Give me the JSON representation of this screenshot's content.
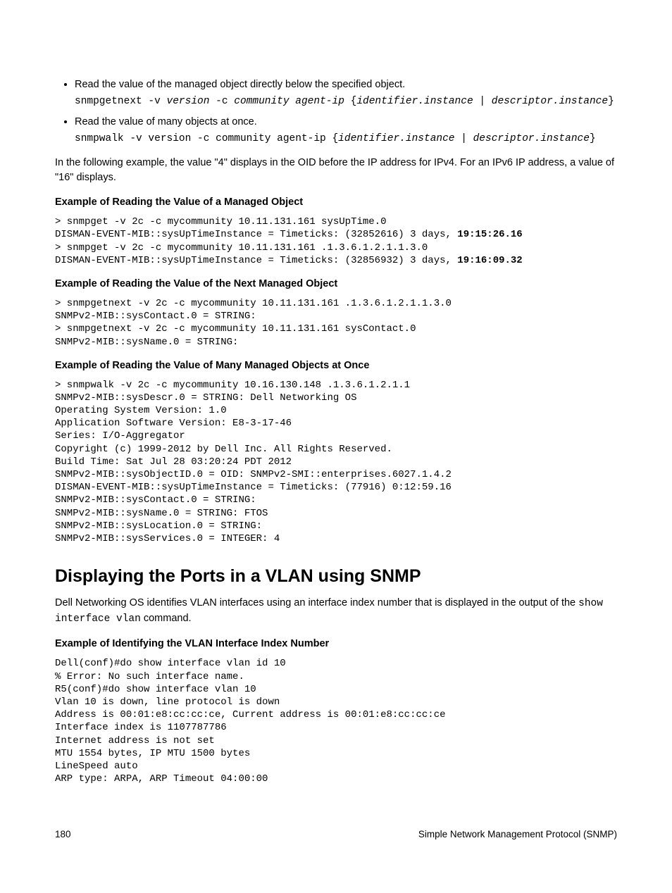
{
  "bullets": {
    "item1": "Read the value of the managed object directly below the specified object.",
    "syntax1a": "snmpgetnext -v ",
    "syntax1b": "version",
    "syntax1c": " -c ",
    "syntax1d": "community agent-ip",
    "syntax1e": " {",
    "syntax1f": "identifier.instance",
    "syntax1g": " | ",
    "syntax1h": "descriptor.instance",
    "syntax1i": "}",
    "item2": "Read the value of many objects at once.",
    "syntax2a": "snmpwalk -v version -c community agent-ip {",
    "syntax2b": "identifier.instance",
    "syntax2c": " | ",
    "syntax2d": "descriptor.instance",
    "syntax2e": "}"
  },
  "para1": "In the following example, the value \"4\" displays in the OID before the IP address for IPv4. For an IPv6 IP address, a value of \"16\" displays.",
  "ex1_title": "Example of Reading the Value of a Managed Object",
  "ex1_l1": "> snmpget -v 2c -c mycommunity 10.11.131.161 sysUpTime.0",
  "ex1_l2": "DISMAN-EVENT-MIB::sysUpTimeInstance = Timeticks: (32852616) 3 days, ",
  "ex1_l2b": "19:15:26.16",
  "ex1_l3": "> snmpget -v 2c -c mycommunity 10.11.131.161 .1.3.6.1.2.1.1.3.0",
  "ex1_l4": "DISMAN-EVENT-MIB::sysUpTimeInstance = Timeticks: (32856932) 3 days, ",
  "ex1_l4b": "19:16:09.32",
  "ex2_title": "Example of Reading the Value of the Next Managed Object",
  "ex2_code": "> snmpgetnext -v 2c -c mycommunity 10.11.131.161 .1.3.6.1.2.1.1.3.0\nSNMPv2-MIB::sysContact.0 = STRING:\n> snmpgetnext -v 2c -c mycommunity 10.11.131.161 sysContact.0\nSNMPv2-MIB::sysName.0 = STRING:",
  "ex3_title": "Example of Reading the Value of Many Managed Objects at Once",
  "ex3_code": "> snmpwalk -v 2c -c mycommunity 10.16.130.148 .1.3.6.1.2.1.1\nSNMPv2-MIB::sysDescr.0 = STRING: Dell Networking OS\nOperating System Version: 1.0\nApplication Software Version: E8-3-17-46\nSeries: I/O-Aggregator\nCopyright (c) 1999-2012 by Dell Inc. All Rights Reserved.\nBuild Time: Sat Jul 28 03:20:24 PDT 2012\nSNMPv2-MIB::sysObjectID.0 = OID: SNMPv2-SMI::enterprises.6027.1.4.2\nDISMAN-EVENT-MIB::sysUpTimeInstance = Timeticks: (77916) 0:12:59.16\nSNMPv2-MIB::sysContact.0 = STRING:\nSNMPv2-MIB::sysName.0 = STRING: FTOS\nSNMPv2-MIB::sysLocation.0 = STRING:\nSNMPv2-MIB::sysServices.0 = INTEGER: 4",
  "section_heading": "Displaying the Ports in a VLAN using SNMP",
  "para2a": "Dell Networking OS identifies VLAN interfaces using an interface index number that is displayed in the output of the ",
  "para2b": "show interface vlan",
  "para2c": " command.",
  "ex4_title": "Example of Identifying the VLAN Interface Index Number",
  "ex4_code": "Dell(conf)#do show interface vlan id 10\n% Error: No such interface name.\nR5(conf)#do show interface vlan 10\nVlan 10 is down, line protocol is down\nAddress is 00:01:e8:cc:cc:ce, Current address is 00:01:e8:cc:cc:ce\nInterface index is 1107787786\nInternet address is not set\nMTU 1554 bytes, IP MTU 1500 bytes\nLineSpeed auto\nARP type: ARPA, ARP Timeout 04:00:00",
  "footer_page": "180",
  "footer_text": "Simple Network Management Protocol (SNMP)"
}
